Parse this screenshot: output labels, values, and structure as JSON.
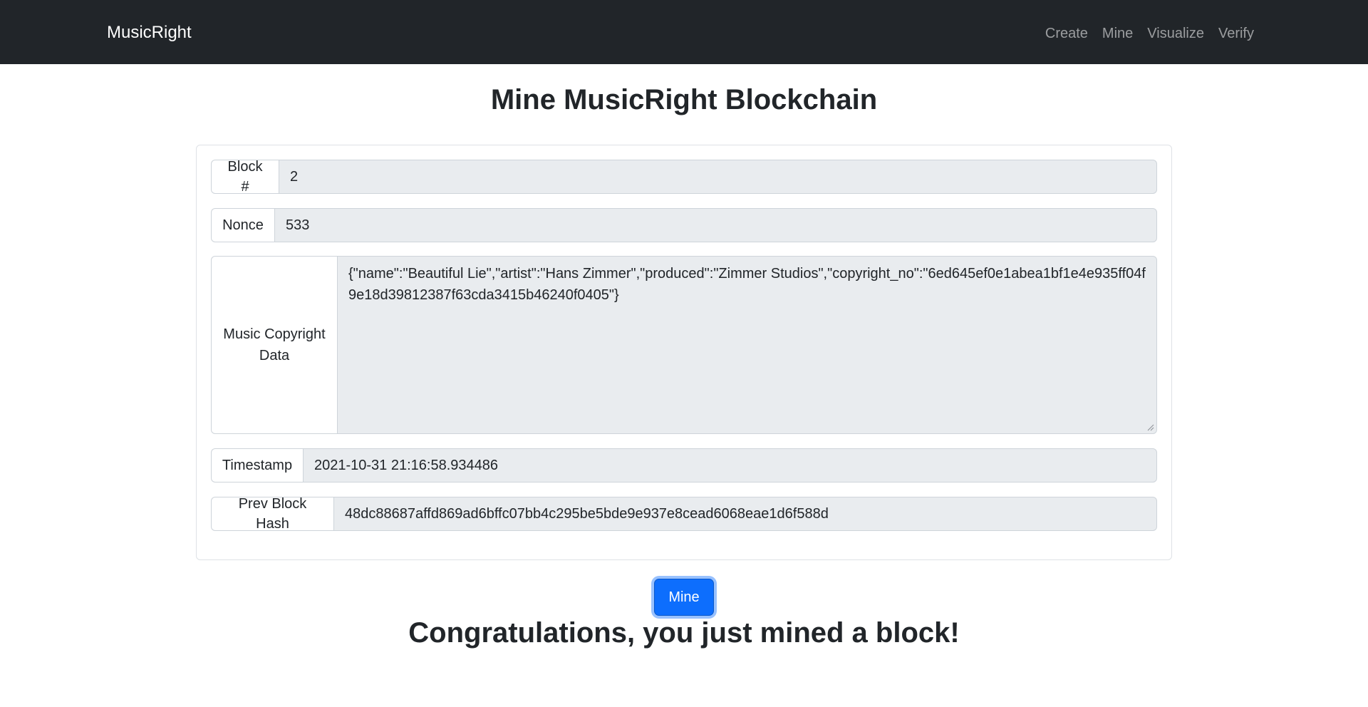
{
  "navbar": {
    "brand": "MusicRight",
    "links": [
      "Create",
      "Mine",
      "Visualize",
      "Verify"
    ]
  },
  "page": {
    "title": "Mine MusicRight Blockchain",
    "congrats": "Congratulations, you just mined a block!"
  },
  "form": {
    "block": {
      "label": "Block #",
      "value": "2"
    },
    "nonce": {
      "label": "Nonce",
      "value": "533"
    },
    "data": {
      "label": "Music Copyright Data",
      "value": "{\"name\":\"Beautiful Lie\",\"artist\":\"Hans Zimmer\",\"produced\":\"Zimmer Studios\",\"copyright_no\":\"6ed645ef0e1abea1bf1e4e935ff04f9e18d39812387f63cda3415b46240f0405\"}"
    },
    "timestamp": {
      "label": "Timestamp",
      "value": "2021-10-31 21:16:58.934486"
    },
    "prev_hash": {
      "label": "Prev Block Hash",
      "value": "48dc88687affd869ad6bffc07bb4c295be5bde9e937e8cead6068eae1d6f588d"
    }
  },
  "actions": {
    "mine_label": "Mine"
  }
}
